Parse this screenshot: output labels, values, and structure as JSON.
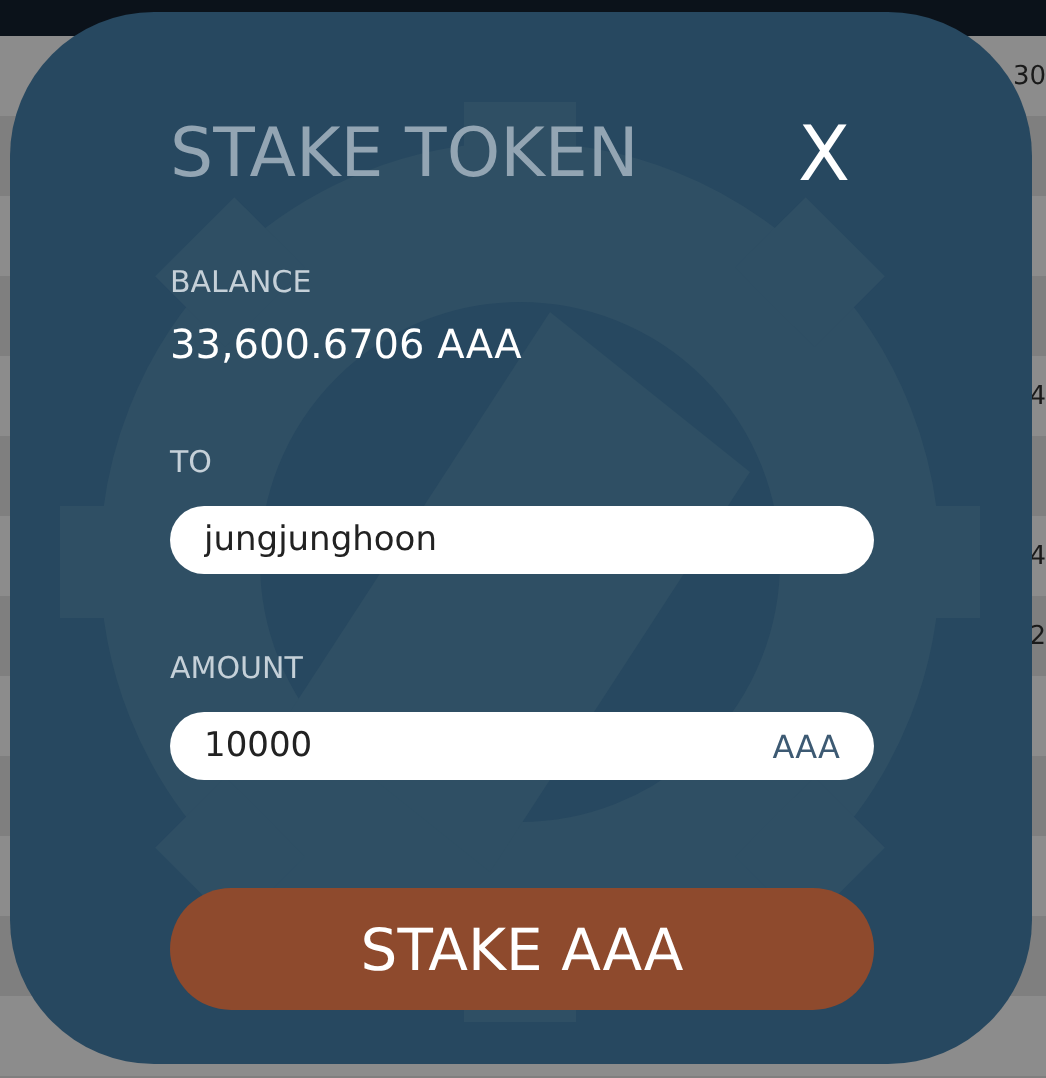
{
  "background_rows": [
    {
      "text": "30"
    },
    {
      "text": ""
    },
    {
      "text": ""
    },
    {
      "text": ""
    },
    {
      "text": "4"
    },
    {
      "text": ""
    },
    {
      "text": "4"
    },
    {
      "text": "2"
    },
    {
      "text": ""
    },
    {
      "text": ""
    },
    {
      "text": ""
    },
    {
      "text": ""
    },
    {
      "text": ""
    }
  ],
  "dialog": {
    "title": "STAKE TOKEN",
    "close": "X",
    "balance_label": "BALANCE",
    "balance": "33,600.6706 AAA",
    "to_label": "TO",
    "to_value": "jungjunghoon",
    "amount_label": "AMOUNT",
    "amount_value": "10000",
    "amount_unit": "AAA",
    "submit": "STAKE AAA"
  }
}
